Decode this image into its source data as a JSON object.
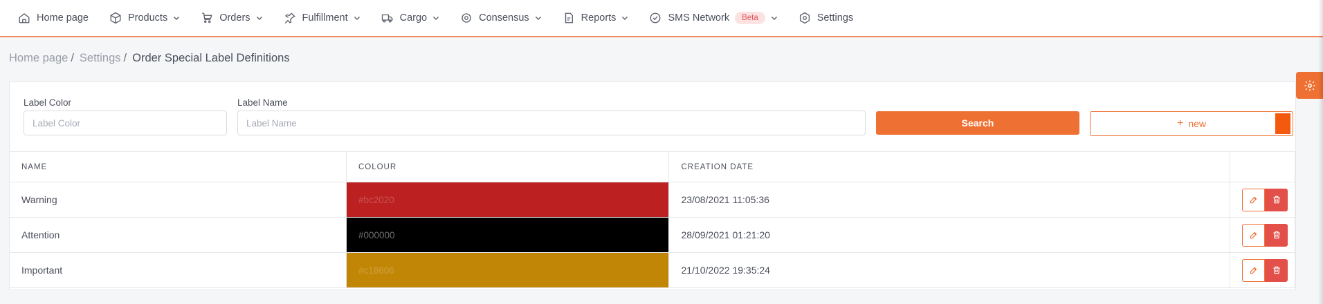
{
  "nav": {
    "items": [
      {
        "label": "Home page",
        "icon": "home-icon",
        "dropdown": false
      },
      {
        "label": "Products",
        "icon": "box-icon",
        "dropdown": true
      },
      {
        "label": "Orders",
        "icon": "cart-icon",
        "dropdown": true
      },
      {
        "label": "Fulfillment",
        "icon": "pin-icon",
        "dropdown": true
      },
      {
        "label": "Cargo",
        "icon": "truck-icon",
        "dropdown": true
      },
      {
        "label": "Consensus",
        "icon": "target-icon",
        "dropdown": true
      },
      {
        "label": "Reports",
        "icon": "report-icon",
        "dropdown": true
      },
      {
        "label": "SMS Network",
        "icon": "check-circle-icon",
        "dropdown": true,
        "badge": "Beta"
      },
      {
        "label": "Settings",
        "icon": "hex-gear-icon",
        "dropdown": false
      }
    ]
  },
  "breadcrumb": {
    "items": [
      "Home page",
      "Settings"
    ],
    "current": "Order Special Label Definitions"
  },
  "filters": {
    "label_color": {
      "label": "Label Color",
      "placeholder": "Label Color",
      "value": ""
    },
    "label_name": {
      "label": "Label Name",
      "placeholder": "Label Name",
      "value": ""
    },
    "search_label": "Search",
    "new_label": "new"
  },
  "table": {
    "headers": [
      "NAME",
      "COLOUR",
      "CREATION DATE",
      ""
    ],
    "rows": [
      {
        "name": "Warning",
        "colour": "#bc2020",
        "date": "23/08/2021 11:05:36"
      },
      {
        "name": "Attention",
        "colour": "#000000",
        "date": "28/09/2021 01:21:20"
      },
      {
        "name": "Important",
        "colour": "#c18606",
        "date": "21/10/2022 19:35:24"
      }
    ]
  },
  "colors": {
    "accent": "#ef7033",
    "danger": "#e35049",
    "beta_bg": "#fde2e2",
    "beta_text": "#e0555a"
  }
}
